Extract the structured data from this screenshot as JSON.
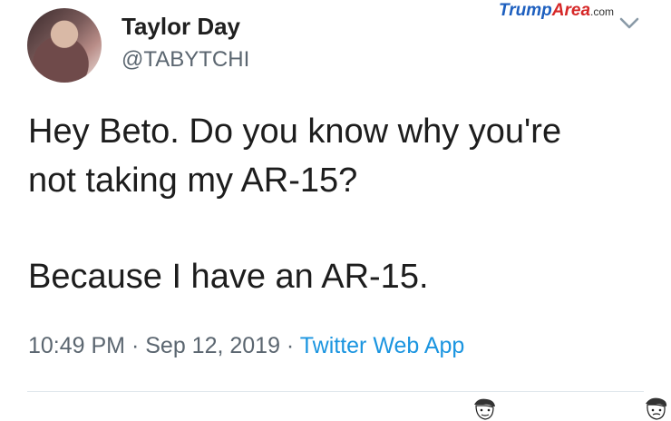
{
  "tweet": {
    "author_name": "Taylor Day",
    "handle": "@TABYTCHI",
    "text_line1": "Hey Beto. Do you know why you're",
    "text_line2": "not taking my AR-15?",
    "text_line3": "Because I have an AR-15.",
    "time": "10:49 PM",
    "sep1": " · ",
    "date": "Sep 12, 2019",
    "sep2": " · ",
    "source": "Twitter Web App",
    "menu_icon": "chevron-down-icon"
  },
  "watermark": {
    "part1": "Trump",
    "part2": "Area",
    "domain": ".com"
  },
  "colors": {
    "link": "#1b95e0",
    "muted": "#5b6670",
    "text": "#1d1d1d"
  }
}
